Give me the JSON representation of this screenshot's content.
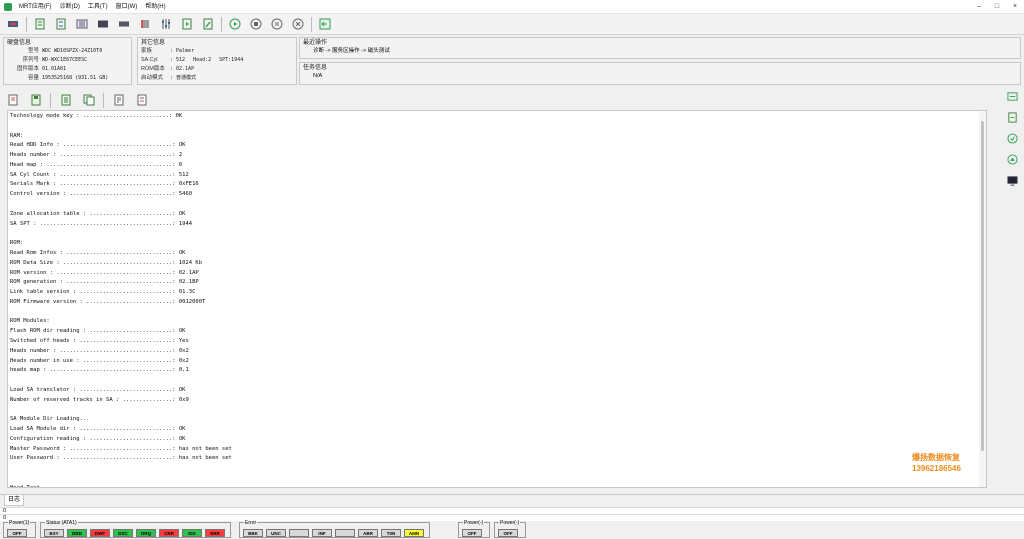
{
  "window": {
    "menu": [
      "MRT应用(F)",
      "诊断(D)",
      "工具(T)",
      "窗口(W)",
      "帮助(H)"
    ],
    "controls": [
      "–",
      "□",
      "×"
    ]
  },
  "disk_info": {
    "title": "硬盘信息",
    "rows": [
      {
        "label": "型号",
        "value": "WDC WD10SPZX-24Z10T0"
      },
      {
        "label": "序列号",
        "value": "WD-WXC1E67CEESC"
      },
      {
        "label": "固件版本",
        "value": "01.01A01"
      },
      {
        "label": "容量",
        "value": "1953525168 (931.51 GB)"
      }
    ]
  },
  "other_info": {
    "title": "其它信息",
    "family_label": "家族",
    "family_value": ": Palmer",
    "sa_cyl_label": "SA Cyl",
    "sa_cyl_value": ": 512",
    "head_value": "Head:2",
    "spt_value": "SPT:1944",
    "rom_label": "ROM版本",
    "rom_value": ": 02.1AP",
    "boot_label": "启动模式",
    "boot_value": ": 普通模式"
  },
  "recent_ops": {
    "title": "最近操作",
    "path": "诊断 -> 服务区操作 -> 磁头测试"
  },
  "task_info": {
    "title": "任务信息",
    "value": "N/A"
  },
  "log": {
    "lines": [
      "Technology mode key : ..........................: 0K",
      "",
      "RAM:",
      "Read HDD Info : .................................: OK",
      "Heads number : ..................................: 2",
      "Head map : ......................................: 0",
      "SA Cyl Count : ..................................: 512",
      "Serials Mark : ..................................: 0xFE16",
      "Control version : ...............................: 5460",
      "",
      "Zone allocation table : .........................: OK",
      "SA SPT : ........................................: 1944",
      "",
      "ROM:",
      "Read Rom Infos : ................................: OK",
      "ROM Data Size : .................................: 1024 Kb",
      "ROM version : ...................................: 02.1AP",
      "ROM generation : ................................: 02.1BP",
      "Link table version : ............................: 01.3C",
      "ROM Firmware version : ..........................: 0012000T",
      "",
      "ROM Modules:",
      "Flash ROM dir reading : .........................: OK",
      "Switched off heads : ............................: Yes",
      "Heads number : ..................................: 0x2",
      "Heads number in use : ...........................: 0x2",
      "heads map : .....................................: 0,1",
      "",
      "Load SA translator : ............................: OK",
      "Number of reserved tracks in SA : ...............: 0x9",
      "",
      "SA Module Dir Loading...",
      "Load SA Module dir : ............................: OK",
      "Configuration reading : .........................: OK",
      "Master Password : ...............................: has not been set",
      "User Password : .................................: has not been set",
      "",
      "",
      "Head Test..."
    ]
  },
  "watermark": {
    "line1": "爆扬数据恢复",
    "line2": "13962186546"
  },
  "tab": {
    "label": "日志"
  },
  "coords": {
    "a": "0",
    "b": "0"
  },
  "status": {
    "power1": {
      "label": "Power(1)",
      "leds": [
        {
          "t": "OFF",
          "c": "#d8d8d8"
        }
      ]
    },
    "ata": {
      "label": "Status (ATA1)",
      "leds": [
        {
          "t": "BSY",
          "c": "#d8d8d8"
        },
        {
          "t": "DRD",
          "c": "#2fc24a"
        },
        {
          "t": "DWF",
          "c": "#ff3b3b"
        },
        {
          "t": "DSC",
          "c": "#2fc24a"
        },
        {
          "t": "DRQ",
          "c": "#2fc24a"
        },
        {
          "t": "CRR",
          "c": "#ff3b3b"
        },
        {
          "t": "IDX",
          "c": "#2fc24a"
        },
        {
          "t": "ERR",
          "c": "#ff3b3b"
        }
      ]
    },
    "error": {
      "label": "Error",
      "leds": [
        {
          "t": "BBK",
          "c": "#d8d8d8"
        },
        {
          "t": "UNC",
          "c": "#d8d8d8"
        },
        {
          "t": "",
          "c": "#d8d8d8"
        },
        {
          "t": "INF",
          "c": "#d8d8d8"
        },
        {
          "t": "",
          "c": "#d8d8d8"
        },
        {
          "t": "ABR",
          "c": "#d8d8d8"
        },
        {
          "t": "T0N",
          "c": "#d8d8d8"
        },
        {
          "t": "AMN",
          "c": "#ffff33"
        }
      ]
    },
    "power2": {
      "label": "Power(-)",
      "leds": [
        {
          "t": "OFF",
          "c": "#d8d8d8"
        }
      ]
    },
    "power3": {
      "label": "Power(-)",
      "leds": [
        {
          "t": "OFF",
          "c": "#d8d8d8"
        }
      ]
    }
  }
}
